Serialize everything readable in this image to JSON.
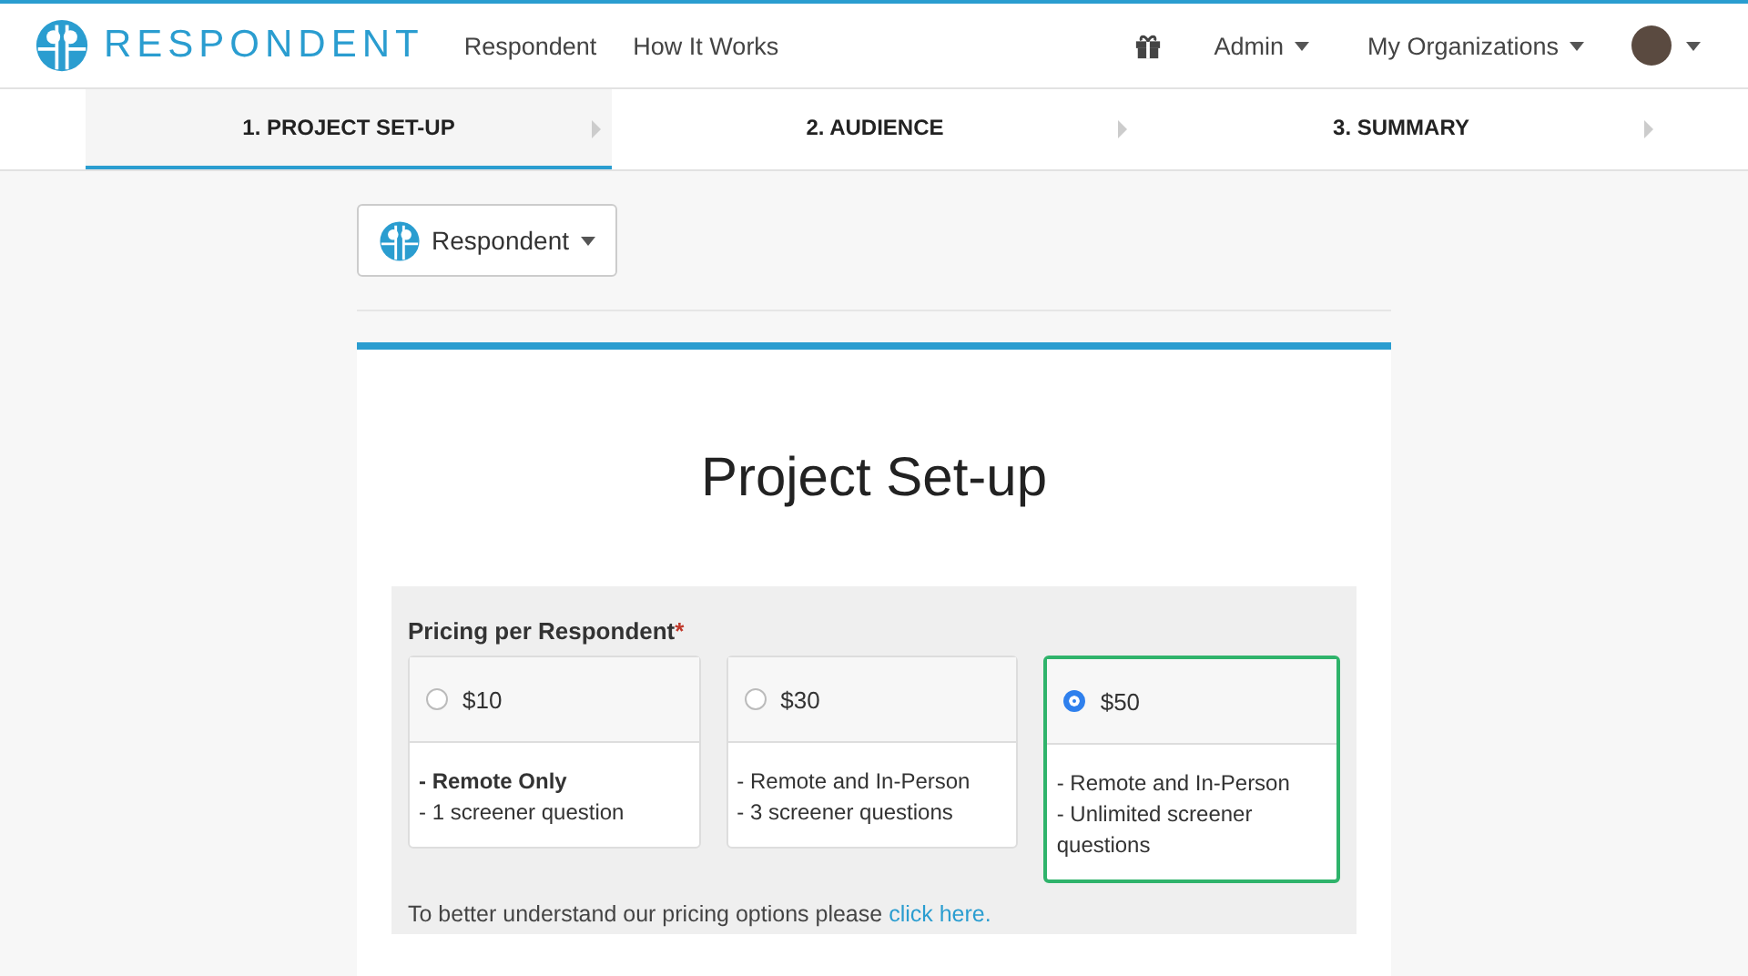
{
  "navbar": {
    "brand": "RESPONDENT",
    "links": [
      "Respondent",
      "How It Works"
    ],
    "menus": [
      "Admin",
      "My Organizations"
    ]
  },
  "steps": [
    {
      "label": "1. PROJECT SET-UP",
      "selected": true
    },
    {
      "label": "2. AUDIENCE",
      "selected": false
    },
    {
      "label": "3. SUMMARY",
      "selected": false
    }
  ],
  "org_dropdown": {
    "label": "Respondent"
  },
  "card": {
    "title": "Project Set-up",
    "pricing": {
      "label": "Pricing per Respondent",
      "required_mark": "*",
      "options": [
        {
          "price": "$10",
          "selected": false,
          "features": [
            "**- Remote Only**",
            "- 1 screener question"
          ]
        },
        {
          "price": "$30",
          "selected": false,
          "features": [
            "- Remote and In-Person",
            "- 3 screener questions"
          ]
        },
        {
          "price": "$50",
          "selected": true,
          "features": [
            "- Remote and In-Person",
            "- Unlimited screener questions"
          ]
        }
      ],
      "note": "To better understand our pricing options please",
      "note_link": "click here."
    }
  }
}
